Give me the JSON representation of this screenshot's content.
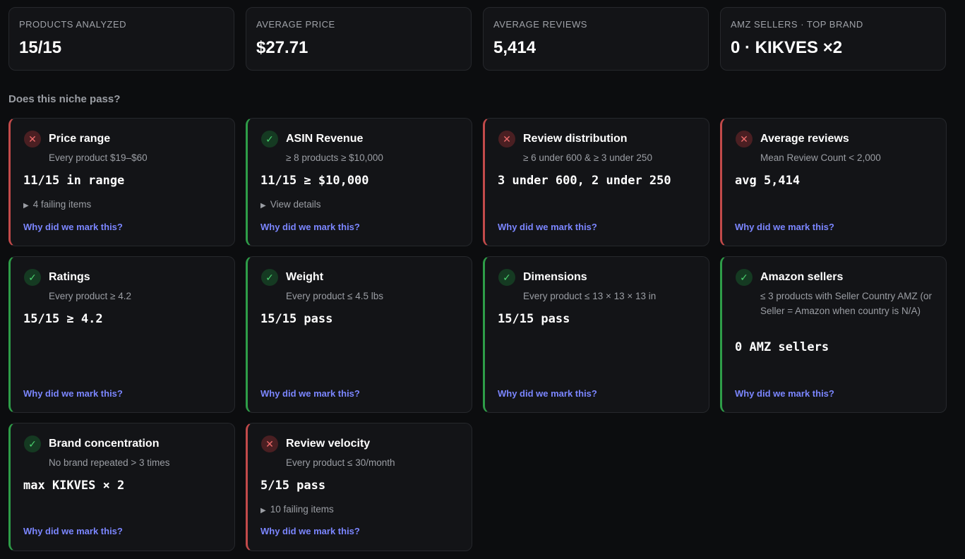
{
  "stats": [
    {
      "label": "PRODUCTS ANALYZED",
      "value": "15/15"
    },
    {
      "label": "AVERAGE PRICE",
      "value": "$27.71"
    },
    {
      "label": "AVERAGE REVIEWS",
      "value": "5,414"
    },
    {
      "label": "AMZ SELLERS · TOP BRAND",
      "value": "0 · KIKVES ×2"
    }
  ],
  "section_title": "Does this niche pass?",
  "link_label": "Why did we mark this?",
  "status_icons": {
    "pass": "✓",
    "fail": "✕"
  },
  "details_arrow": "▶",
  "cards": [
    {
      "status": "fail",
      "title": "Price range",
      "subtitle": "Every product $19–$60",
      "metric": "11/15 in range",
      "details": "4 failing items"
    },
    {
      "status": "pass",
      "title": "ASIN Revenue",
      "subtitle": "≥ 8 products ≥ $10,000",
      "metric": "11/15 ≥ $10,000",
      "details": "View details"
    },
    {
      "status": "fail",
      "title": "Review distribution",
      "subtitle": "≥ 6 under 600 & ≥ 3 under 250",
      "metric": "3 under 600, 2 under 250"
    },
    {
      "status": "fail",
      "title": "Average reviews",
      "subtitle": "Mean Review Count < 2,000",
      "metric": "avg 5,414"
    },
    {
      "status": "pass",
      "title": "Ratings",
      "subtitle": "Every product ≥ 4.2",
      "metric": "15/15 ≥ 4.2"
    },
    {
      "status": "pass",
      "title": "Weight",
      "subtitle": "Every product ≤ 4.5 lbs",
      "metric": "15/15 pass"
    },
    {
      "status": "pass",
      "title": "Dimensions",
      "subtitle": "Every product ≤ 13 × 13 × 13 in",
      "metric": "15/15 pass"
    },
    {
      "status": "pass",
      "title": "Amazon sellers",
      "subtitle": "≤ 3 products with Seller Country AMZ (or Seller = Amazon when country is N/A)",
      "metric": "0 AMZ sellers"
    },
    {
      "status": "pass",
      "title": "Brand concentration",
      "subtitle": "No brand repeated > 3 times",
      "metric": "max KIKVES × 2"
    },
    {
      "status": "fail",
      "title": "Review velocity",
      "subtitle": "Every product ≤ 30/month",
      "metric": "5/15 pass",
      "details": "10 failing items"
    }
  ]
}
